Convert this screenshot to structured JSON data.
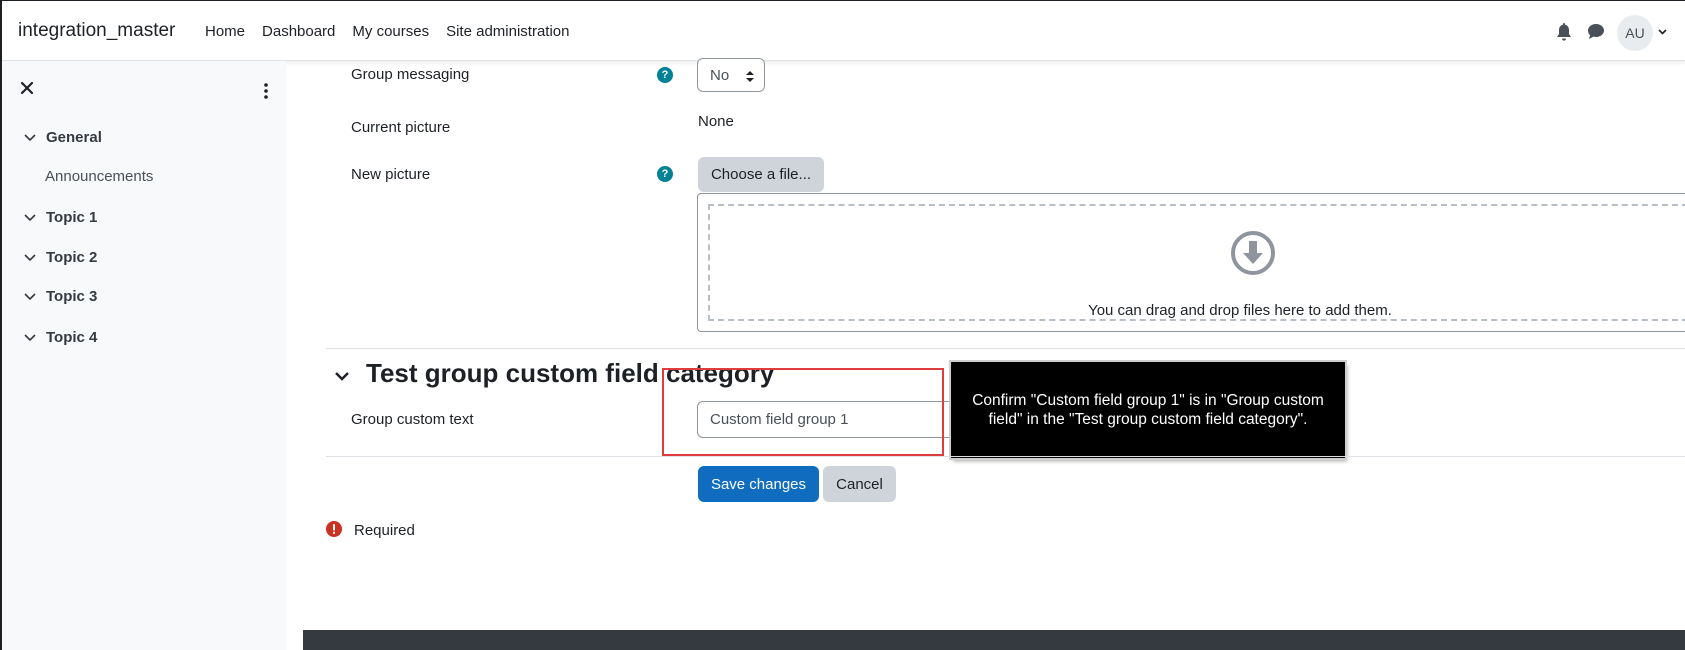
{
  "navbar": {
    "brand": "integration_master",
    "links": [
      "Home",
      "Dashboard",
      "My courses",
      "Site administration"
    ],
    "avatar_initials": "AU",
    "icons": [
      "bell-icon",
      "chat-icon",
      "chevron-down-icon"
    ]
  },
  "sidebar": {
    "sections": [
      {
        "label": "General",
        "items": [
          "Announcements"
        ]
      },
      {
        "label": "Topic 1"
      },
      {
        "label": "Topic 2"
      },
      {
        "label": "Topic 3"
      },
      {
        "label": "Topic 4"
      }
    ]
  },
  "form": {
    "group_messaging_label": "Group messaging",
    "group_messaging_value": "No",
    "current_picture_label": "Current picture",
    "current_picture_value": "None",
    "new_picture_label": "New picture",
    "choose_file_label": "Choose a file...",
    "dropzone_text": "You can drag and drop files here to add them.",
    "section_title": "Test group custom field category",
    "custom_text_label": "Group custom text",
    "custom_text_value": "Custom field group 1",
    "save_label": "Save changes",
    "cancel_label": "Cancel",
    "required_label": "Required"
  },
  "tooltip": {
    "text": "Confirm \"Custom field group 1\" is in \"Group custom field\" in the \"Test group custom field category\"."
  },
  "colors": {
    "primary": "#0f6cbf",
    "help": "#008196",
    "highlight": "#e03c3c",
    "danger": "#ca3120"
  }
}
